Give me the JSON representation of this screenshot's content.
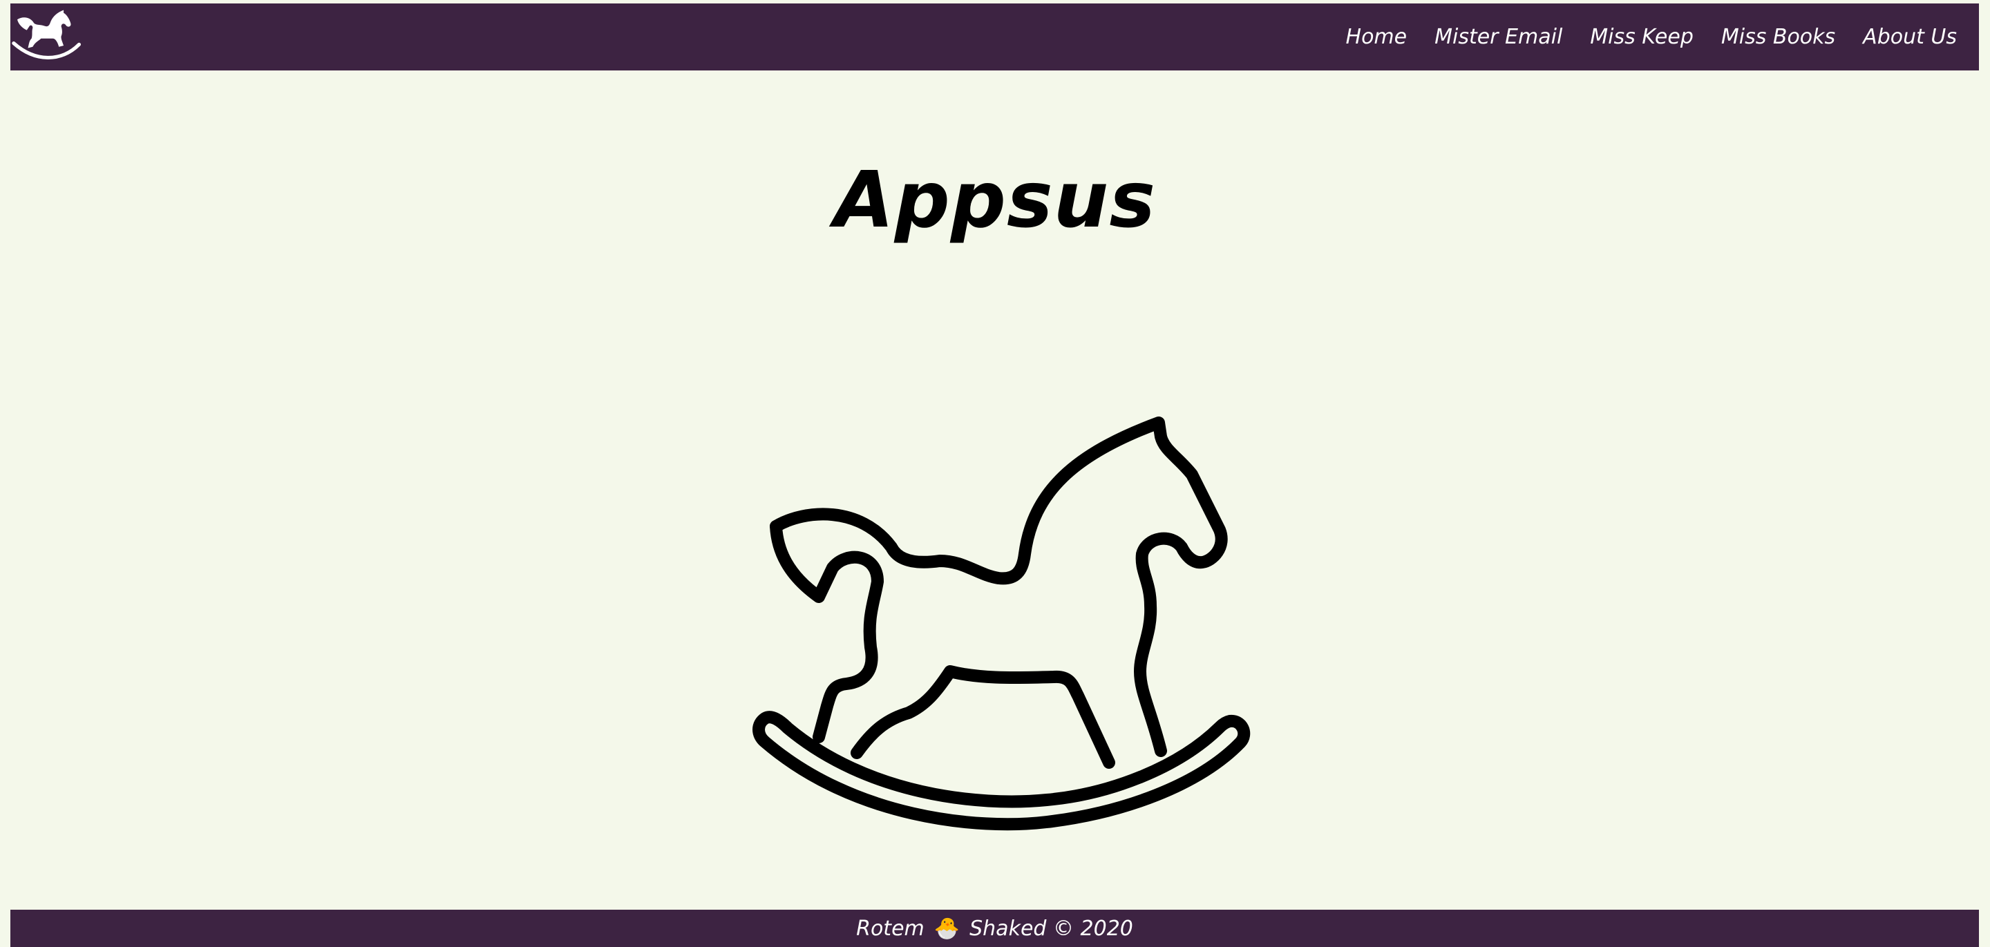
{
  "header": {
    "logo_icon": "rocking-horse-icon",
    "nav": [
      {
        "label": "Home"
      },
      {
        "label": "Mister Email"
      },
      {
        "label": "Miss Keep"
      },
      {
        "label": "Miss Books"
      },
      {
        "label": "About Us"
      }
    ]
  },
  "main": {
    "title": "Appsus",
    "hero_icon": "rocking-horse-icon"
  },
  "footer": {
    "name1": "Rotem",
    "emoji": "🐣",
    "name2": "Shaked",
    "copyright": "© 2020"
  },
  "colors": {
    "bar": "#3d2342",
    "background": "#f4f8ea",
    "text_on_bar": "#ffffff"
  }
}
